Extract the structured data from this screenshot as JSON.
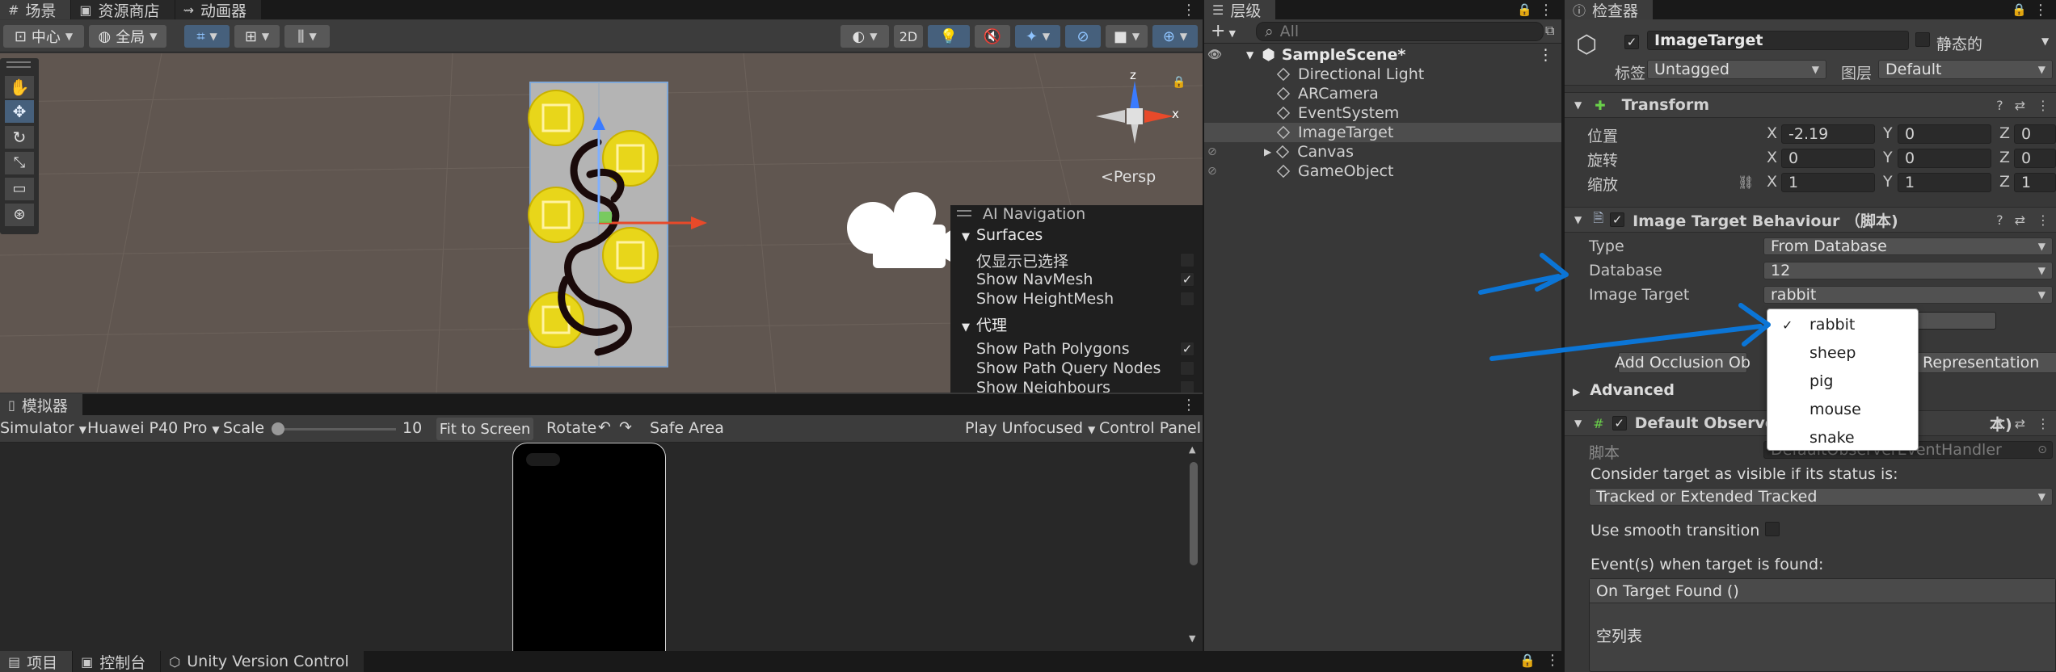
{
  "scene_panel": {
    "tabs": [
      "场景",
      "资源商店",
      "动画器"
    ],
    "pivot_label": "中心",
    "space_label": "全局",
    "mode_2d": "2D",
    "persp_label": "<Persp",
    "axis_x": "x",
    "axis_z": "z"
  },
  "ai_navigation": {
    "title": "AI Navigation",
    "surfaces_header": "Surfaces",
    "surface_items": [
      {
        "label": "仅显示已选择",
        "checked": false
      },
      {
        "label": "Show NavMesh",
        "checked": true
      },
      {
        "label": "Show HeightMesh",
        "checked": false
      }
    ],
    "agent_header": "代理",
    "agent_items": [
      {
        "label": "Show Path Polygons",
        "checked": true
      },
      {
        "label": "Show Path Query Nodes",
        "checked": false
      },
      {
        "label": "Show Neighbours",
        "checked": false
      }
    ]
  },
  "simulator": {
    "tab": "模拟器",
    "mode": "Simulator",
    "device": "Huawei P40 Pro",
    "scale_label": "Scale",
    "scale_value": "10",
    "fit_button": "Fit to Screen",
    "rotate_label": "Rotate",
    "safe_area": "Safe Area",
    "play_mode": "Play Unfocused",
    "control_panel": "Control Panel"
  },
  "bottom_tabs": [
    "项目",
    "控制台",
    "Unity Version Control"
  ],
  "hierarchy": {
    "tab": "层级",
    "search_placeholder": "All",
    "scene": "SampleScene*",
    "items": [
      "Directional Light",
      "ARCamera",
      "EventSystem",
      "ImageTarget",
      "Canvas",
      "GameObject"
    ]
  },
  "inspector": {
    "tab": "检查器",
    "object_name": "ImageTarget",
    "static_label": "静态的",
    "tag_label": "标签",
    "tag_value": "Untagged",
    "layer_label": "图层",
    "layer_value": "Default",
    "transform": {
      "title": "Transform",
      "rows": [
        {
          "label": "位置",
          "x": "-2.19",
          "y": "0",
          "z": "0"
        },
        {
          "label": "旋转",
          "x": "0",
          "y": "0",
          "z": "0"
        },
        {
          "label": "缩放",
          "x": "1",
          "y": "1",
          "z": "1"
        }
      ]
    },
    "itb": {
      "title": "Image Target Behaviour （脚本)",
      "type_label": "Type",
      "type_value": "From Database",
      "database_label": "Database",
      "database_value": "12",
      "target_label": "Image Target",
      "target_value": "rabbit",
      "occlusion_button_left": "Add Occlusion Ob",
      "occlusion_button_right": "Representation"
    },
    "advanced": "Advanced",
    "dob": {
      "title_left": "Default Observe",
      "title_right": "本)",
      "script_label": "脚本",
      "script_value": "DefaultObserverEventHandler",
      "visible_label": "Consider target as visible if its status is:",
      "visible_value": "Tracked or Extended Tracked",
      "smooth_label": "Use smooth transition o",
      "events_label": "Event(s) when target is found:",
      "on_found": "On Target Found ()",
      "empty_list": "空列表"
    },
    "dropdown_options": [
      {
        "label": "rabbit",
        "selected": true
      },
      {
        "label": "sheep",
        "selected": false
      },
      {
        "label": "pig",
        "selected": false
      },
      {
        "label": "mouse",
        "selected": false
      },
      {
        "label": "snake",
        "selected": false
      }
    ]
  },
  "colors": {
    "accent_blue": "#0b75d6",
    "selection_blue": "#46607c",
    "panel_bg": "#383838"
  }
}
